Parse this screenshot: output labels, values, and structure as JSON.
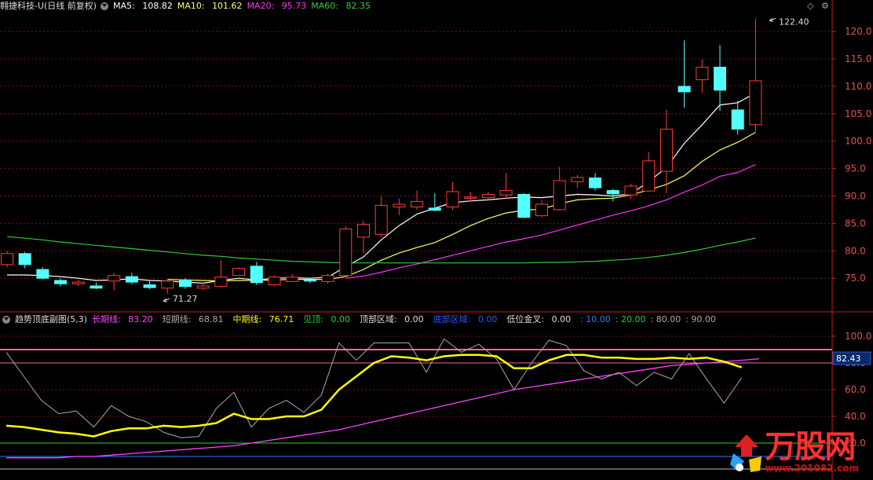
{
  "header_main": {
    "stock": "翱捷科技-U(日线 前复权)",
    "ma5_label": "MA5:",
    "ma5_value": "108.82",
    "ma10_label": "MA10:",
    "ma10_value": "101.62",
    "ma20_label": "MA20:",
    "ma20_value": "95.73",
    "ma60_label": "MA60:",
    "ma60_value": "82.35"
  },
  "header_sub": {
    "title": "趋势顶底副图(5,3)",
    "long_label": "长期线:",
    "long_value": "83.20",
    "short_label": "短期线:",
    "short_value": "68.81",
    "mid_label": "中期线:",
    "mid_value": "76.71",
    "top_label": "见顶:",
    "top_value": "0.00",
    "topzone_label": "顶部区域:",
    "topzone_value": "0.00",
    "bottomzone_label": "底部区域:",
    "bottomzone_value": "0.00",
    "gold_label": "低位金叉:",
    "gold_value": "0.00",
    "lvl1": ": 10.00",
    "lvl2": ": 20.00",
    "lvl3": ": 80.00",
    "lvl4": ": 90.00"
  },
  "controls": {
    "diamond": "◇",
    "settings": "⚙"
  },
  "watermark": {
    "text": "万股网",
    "url": "www.201082.com"
  },
  "colors": {
    "up": "#ff3b3b",
    "down": "#54ffff",
    "ma5": "#ffffff",
    "ma10": "#ffff66",
    "ma20": "#ff33ff",
    "ma60": "#33cc33",
    "long": "#ff44ff",
    "short": "#aaaaaa",
    "mid": "#ffff00",
    "axis": "#c81e1e",
    "grid": "#7a1010"
  },
  "chart_data": [
    {
      "type": "candlestick",
      "ylim": [
        72,
        122.4
      ],
      "y_ticks": [
        75.0,
        80.0,
        85.0,
        90.0,
        95.0,
        100.0,
        105.0,
        110.0,
        115.0,
        120.0
      ],
      "annotations": [
        {
          "text": "122.40",
          "value": 122.4
        },
        {
          "text": "71.27",
          "value": 71.27
        }
      ],
      "candles": [
        {
          "o": 77.5,
          "c": 79.5,
          "h": 80.0,
          "l": 77.0
        },
        {
          "o": 79.5,
          "c": 77.5,
          "h": 79.8,
          "l": 76.8
        },
        {
          "o": 76.6,
          "c": 75.0,
          "h": 77.0,
          "l": 74.8
        },
        {
          "o": 74.6,
          "c": 74.0,
          "h": 75.0,
          "l": 73.5
        },
        {
          "o": 74.0,
          "c": 74.3,
          "h": 74.8,
          "l": 73.6
        },
        {
          "o": 73.6,
          "c": 73.2,
          "h": 74.2,
          "l": 73.0
        },
        {
          "o": 74.5,
          "c": 75.5,
          "h": 76.0,
          "l": 72.8
        },
        {
          "o": 75.3,
          "c": 74.3,
          "h": 76.0,
          "l": 73.9
        },
        {
          "o": 73.8,
          "c": 73.3,
          "h": 74.6,
          "l": 73.0
        },
        {
          "o": 73.2,
          "c": 74.5,
          "h": 74.9,
          "l": 72.2
        },
        {
          "o": 74.7,
          "c": 73.5,
          "h": 75.0,
          "l": 73.1
        },
        {
          "o": 73.2,
          "c": 73.6,
          "h": 74.2,
          "l": 72.8
        },
        {
          "o": 73.5,
          "c": 75.2,
          "h": 78.3,
          "l": 73.3
        },
        {
          "o": 75.5,
          "c": 76.8,
          "h": 77.0,
          "l": 75.4
        },
        {
          "o": 77.2,
          "c": 74.2,
          "h": 78.0,
          "l": 73.8
        },
        {
          "o": 73.8,
          "c": 75.2,
          "h": 75.5,
          "l": 73.5
        },
        {
          "o": 74.4,
          "c": 75.2,
          "h": 75.8,
          "l": 74.4
        },
        {
          "o": 74.7,
          "c": 74.5,
          "h": 75.0,
          "l": 74.1
        },
        {
          "o": 74.4,
          "c": 75.5,
          "h": 75.8,
          "l": 74.0
        },
        {
          "o": 75.5,
          "c": 84.0,
          "h": 84.5,
          "l": 75.2
        },
        {
          "o": 82.5,
          "c": 84.8,
          "h": 85.5,
          "l": 79.5
        },
        {
          "o": 83.0,
          "c": 88.3,
          "h": 90.0,
          "l": 82.5
        },
        {
          "o": 88.0,
          "c": 88.5,
          "h": 89.5,
          "l": 86.5
        },
        {
          "o": 88.0,
          "c": 89.0,
          "h": 91.0,
          "l": 87.5
        },
        {
          "o": 87.8,
          "c": 87.4,
          "h": 90.5,
          "l": 87.2
        },
        {
          "o": 88.0,
          "c": 90.8,
          "h": 92.5,
          "l": 87.5
        },
        {
          "o": 89.7,
          "c": 89.8,
          "h": 90.8,
          "l": 89.0
        },
        {
          "o": 89.7,
          "c": 90.3,
          "h": 90.8,
          "l": 89.2
        },
        {
          "o": 90.2,
          "c": 91.0,
          "h": 94.2,
          "l": 89.5
        },
        {
          "o": 90.3,
          "c": 86.1,
          "h": 90.5,
          "l": 86.0
        },
        {
          "o": 86.4,
          "c": 88.5,
          "h": 89.2,
          "l": 86.2
        },
        {
          "o": 87.5,
          "c": 92.8,
          "h": 95.3,
          "l": 87.3
        },
        {
          "o": 92.6,
          "c": 93.4,
          "h": 93.8,
          "l": 91.5
        },
        {
          "o": 93.3,
          "c": 91.5,
          "h": 94.2,
          "l": 91.0
        },
        {
          "o": 91.0,
          "c": 90.4,
          "h": 91.3,
          "l": 89.0
        },
        {
          "o": 90.2,
          "c": 91.8,
          "h": 92.2,
          "l": 89.5
        },
        {
          "o": 90.9,
          "c": 96.4,
          "h": 98.0,
          "l": 90.8
        },
        {
          "o": 94.5,
          "c": 102.2,
          "h": 105.7,
          "l": 90.5
        },
        {
          "o": 110.0,
          "c": 109.0,
          "h": 118.4,
          "l": 106.1
        },
        {
          "o": 111.2,
          "c": 113.5,
          "h": 114.9,
          "l": 108.8
        },
        {
          "o": 113.5,
          "c": 109.3,
          "h": 117.5,
          "l": 105.5
        },
        {
          "o": 105.7,
          "c": 102.2,
          "h": 107.4,
          "l": 101.2
        },
        {
          "o": 103.0,
          "c": 111.0,
          "h": 122.4,
          "l": 101.5
        }
      ],
      "series": [
        {
          "name": "MA5",
          "values": [
            75.6,
            75.6,
            75.5,
            75.3,
            75.0,
            74.6,
            74.7,
            74.9,
            74.6,
            74.5,
            74.3,
            74.1,
            74.6,
            75.0,
            74.7,
            75.0,
            75.1,
            75.0,
            75.2,
            77.1,
            78.9,
            82.0,
            84.6,
            86.7,
            87.8,
            88.8,
            89.1,
            89.3,
            89.6,
            89.8,
            89.7,
            90.0,
            90.3,
            90.2,
            90.0,
            90.4,
            92.6,
            95.2,
            99.6,
            103.0,
            106.6,
            107.0,
            108.8
          ]
        },
        {
          "name": "MA10",
          "values": [
            null,
            null,
            null,
            null,
            null,
            null,
            null,
            null,
            null,
            74.8,
            74.7,
            74.6,
            74.5,
            74.6,
            74.6,
            74.7,
            74.8,
            74.8,
            74.8,
            75.3,
            76.6,
            78.3,
            79.6,
            80.6,
            81.5,
            83.0,
            84.6,
            85.9,
            86.9,
            87.4,
            87.6,
            88.6,
            89.3,
            89.5,
            89.6,
            90.2,
            91.1,
            92.1,
            93.7,
            96.3,
            98.4,
            99.8,
            101.6
          ]
        },
        {
          "name": "MA20",
          "values": [
            null,
            null,
            null,
            null,
            null,
            null,
            null,
            null,
            null,
            null,
            null,
            null,
            null,
            null,
            null,
            null,
            null,
            null,
            null,
            75.0,
            75.4,
            76.1,
            76.9,
            77.6,
            78.4,
            79.2,
            80.0,
            80.8,
            81.6,
            82.2,
            82.9,
            83.8,
            84.7,
            85.6,
            86.5,
            87.3,
            88.2,
            89.3,
            90.7,
            92.0,
            93.6,
            94.3,
            95.73
          ]
        },
        {
          "name": "MA60",
          "values": [
            82.6,
            82.3,
            82.0,
            81.6,
            81.3,
            81.0,
            80.7,
            80.4,
            80.1,
            79.8,
            79.5,
            79.2,
            79.0,
            78.7,
            78.5,
            78.3,
            78.1,
            78.0,
            77.9,
            77.8,
            77.8,
            77.8,
            77.8,
            77.8,
            77.8,
            77.8,
            77.8,
            77.8,
            77.8,
            77.8,
            77.9,
            77.9,
            78.0,
            78.1,
            78.3,
            78.5,
            78.8,
            79.2,
            79.7,
            80.3,
            81.0,
            81.6,
            82.35
          ]
        }
      ]
    },
    {
      "type": "line",
      "title": "趋势顶底副图(5,3)",
      "ylim": [
        0,
        110
      ],
      "y_ticks": [
        20.0,
        40.0,
        60.0,
        80.0,
        100.0
      ],
      "current_value_label": "82.43",
      "reference_levels": [
        10,
        20,
        80,
        90
      ],
      "series": [
        {
          "name": "长期线",
          "values": [
            9,
            9,
            9,
            9,
            10,
            10,
            11,
            12,
            13,
            14,
            15,
            16,
            17,
            18,
            20,
            22,
            24,
            26,
            28,
            30,
            33,
            36,
            39,
            42,
            45,
            48,
            51,
            54,
            57,
            60,
            62,
            64,
            66,
            68,
            70,
            72,
            74,
            76,
            78,
            79,
            80,
            81,
            82,
            83.2
          ]
        },
        {
          "name": "短期线",
          "values": [
            88,
            70,
            52,
            42,
            44,
            32,
            48,
            40,
            36,
            28,
            24,
            25,
            46,
            58,
            32,
            46,
            52,
            43,
            56,
            95,
            82,
            95,
            95,
            95,
            73,
            98,
            88,
            94,
            83,
            60,
            80,
            97,
            93,
            74,
            68,
            73,
            63,
            73,
            68,
            87,
            68,
            50,
            68.81
          ]
        },
        {
          "name": "中期线",
          "values": [
            33,
            32,
            30,
            28,
            27,
            25,
            29,
            31,
            31,
            33,
            32,
            33,
            35,
            42,
            38,
            38,
            40,
            40,
            45,
            60,
            70,
            80,
            85,
            84,
            82,
            85,
            86,
            86,
            85,
            76,
            76,
            82,
            86,
            86,
            84,
            84,
            83,
            83,
            84,
            83,
            84,
            81,
            76.71
          ]
        }
      ]
    }
  ]
}
